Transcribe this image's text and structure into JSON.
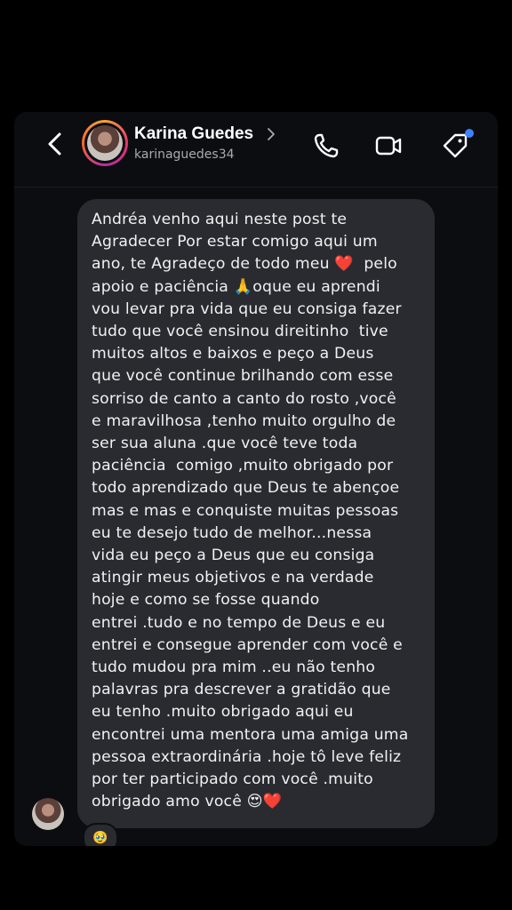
{
  "header": {
    "name": "Karina Guedes",
    "username": "karinaguedes34"
  },
  "message": {
    "text": "Andréa venho aqui neste post te\nAgradecer Por estar comigo aqui um\nano, te Agradeço de todo meu ❤️  pelo\napoio e paciência 🙏oque eu aprendi\nvou levar pra vida que eu consiga fazer\ntudo que você ensinou direitinho  tive\nmuitos altos e baixos e peço a Deus\nque você continue brilhando com esse\nsorriso de canto a canto do rosto ,você\ne maravilhosa ,tenho muito orgulho de\nser sua aluna .que você teve toda\npaciência  comigo ,muito obrigado por\ntodo aprendizado que Deus te abençoe\nmas e mas e conquiste muitas pessoas\neu te desejo tudo de melhor...nessa\nvida eu peço a Deus que eu consiga\natingir meus objetivos e na verdade\nhoje e como se fosse quando\nentrei .tudo e no tempo de Deus e eu\nentrei e consegue aprender com você e\ntudo mudou pra mim ..eu não tenho\npalavras pra descrever a gratidão que\neu tenho .muito obrigado aqui eu\nencontrei uma mentora uma amiga uma\npessoa extraordinária .hoje tô leve feliz\npor ter participado com você .muito\nobrigado amo você 😍❤️",
    "reaction": "🥹"
  },
  "icons": {
    "back": "chevron-left-icon",
    "profile_chevron": "chevron-right-icon",
    "call": "phone-icon",
    "video": "video-camera-icon",
    "tag": "tag-icon"
  },
  "colors": {
    "background": "#000000",
    "card": "#0c0d11",
    "bubble": "#2a2b30",
    "unread_dot": "#3e82ff"
  }
}
